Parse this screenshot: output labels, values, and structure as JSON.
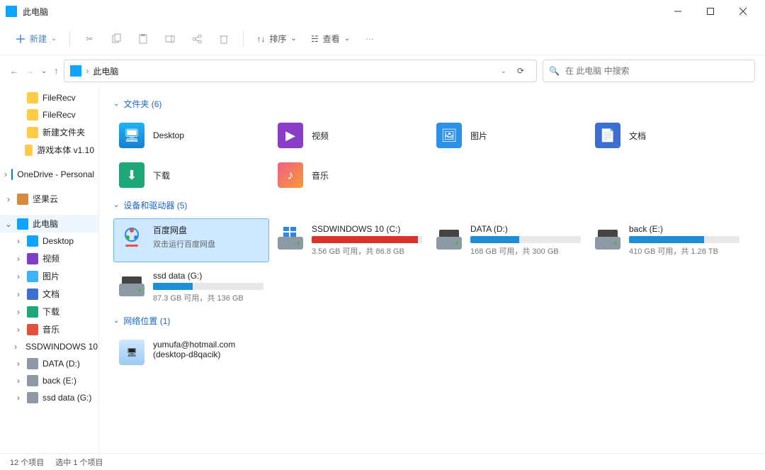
{
  "window": {
    "title": "此电脑"
  },
  "toolbar": {
    "new": "新建",
    "sort": "排序",
    "view": "查看"
  },
  "address": {
    "path": "此电脑",
    "search_placeholder": "在 此电脑 中搜索"
  },
  "sidebar": {
    "items": [
      {
        "label": "FileRecv",
        "icon": "sfolder",
        "indent": 1
      },
      {
        "label": "FileRecv",
        "icon": "sfolder",
        "indent": 1
      },
      {
        "label": "新建文件夹",
        "icon": "sfolder",
        "indent": 1
      },
      {
        "label": "游戏本体 v1.10",
        "icon": "sfolder",
        "indent": 1
      },
      {
        "label": "OneDrive - Personal",
        "icon": "scloud",
        "indent": 0,
        "exp": "›"
      },
      {
        "label": "坚果云",
        "icon": "snut",
        "indent": 0,
        "exp": "›"
      },
      {
        "label": "此电脑",
        "icon": "spc",
        "indent": 0,
        "exp": "⌄",
        "sel": true
      },
      {
        "label": "Desktop",
        "icon": "spc",
        "indent": 1,
        "exp": "›"
      },
      {
        "label": "视频",
        "icon": "svideo",
        "indent": 1,
        "exp": "›"
      },
      {
        "label": "图片",
        "icon": "simg",
        "indent": 1,
        "exp": "›"
      },
      {
        "label": "文档",
        "icon": "sdoc",
        "indent": 1,
        "exp": "›"
      },
      {
        "label": "下载",
        "icon": "sdown",
        "indent": 1,
        "exp": "›"
      },
      {
        "label": "音乐",
        "icon": "smusic",
        "indent": 1,
        "exp": "›"
      },
      {
        "label": "SSDWINDOWS 10 (C:)",
        "icon": "sdrive",
        "indent": 1,
        "exp": "›"
      },
      {
        "label": "DATA (D:)",
        "icon": "sdrive",
        "indent": 1,
        "exp": "›"
      },
      {
        "label": "back (E:)",
        "icon": "sdrive",
        "indent": 1,
        "exp": "›"
      },
      {
        "label": "ssd data (G:)",
        "icon": "sdrive",
        "indent": 1,
        "exp": "›"
      }
    ]
  },
  "groups": {
    "folders": {
      "title": "文件夹 (6)"
    },
    "drives": {
      "title": "设备和驱动器 (5)"
    },
    "network": {
      "title": "网络位置 (1)"
    }
  },
  "folders": [
    {
      "name": "Desktop",
      "cls": "f-desktop",
      "glyph": "🖥"
    },
    {
      "name": "视频",
      "cls": "f-video",
      "glyph": "▶"
    },
    {
      "name": "图片",
      "cls": "f-pic",
      "glyph": "🖼"
    },
    {
      "name": "文档",
      "cls": "f-doc",
      "glyph": "📄"
    },
    {
      "name": "下载",
      "cls": "f-down",
      "glyph": "⬇"
    },
    {
      "name": "音乐",
      "cls": "f-music",
      "glyph": "♪"
    }
  ],
  "drives": [
    {
      "name": "百度网盘",
      "sub": "双击运行百度网盘",
      "app": true,
      "sel": true
    },
    {
      "name": "SSDWINDOWS 10 (C:)",
      "stat": "3.56 GB 可用，共 86.8 GB",
      "pct": 96,
      "color": "#d9332b",
      "win": true
    },
    {
      "name": "DATA (D:)",
      "stat": "168 GB 可用，共 300 GB",
      "pct": 44,
      "color": "#1f8dd6"
    },
    {
      "name": "back (E:)",
      "stat": "410 GB 可用，共 1.28 TB",
      "pct": 68,
      "color": "#1f8dd6"
    },
    {
      "name": "ssd data (G:)",
      "stat": "87.3 GB 可用，共 136 GB",
      "pct": 36,
      "color": "#1f8dd6"
    }
  ],
  "network": [
    {
      "name": "yumufa@hotmail.com",
      "sub": "(desktop-d8qacik)"
    }
  ],
  "status": {
    "count": "12 个项目",
    "selected": "选中 1 个项目"
  }
}
